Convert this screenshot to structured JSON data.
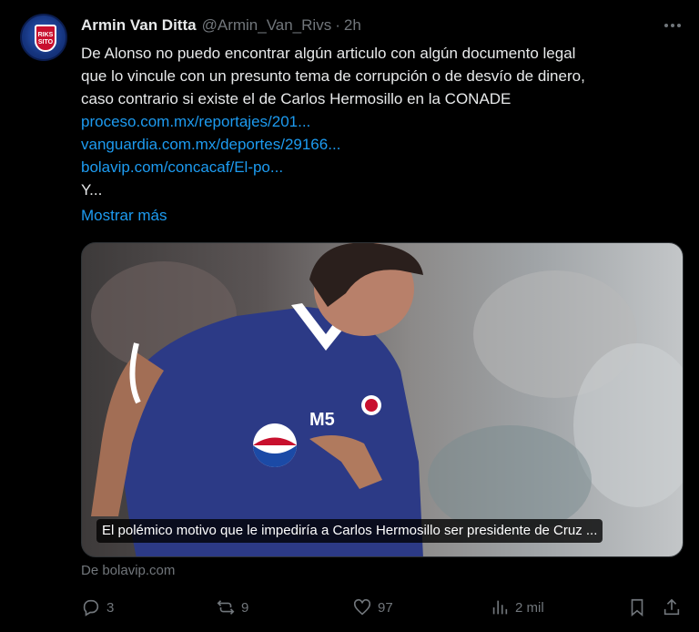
{
  "tweet": {
    "author_name": "Armin Van Ditta",
    "author_handle": "@Armin_Van_Rivs",
    "separator": "·",
    "time": "2h",
    "avatar_text": "RIKS SITO",
    "text_lines": [
      "De Alonso no puedo encontrar algún articulo con algún documento legal",
      "que lo vincule con un presunto tema de corrupción o de desvío de dinero,",
      "caso contrario si existe el de Carlos Hermosillo en la CONADE"
    ],
    "links": [
      "proceso.com.mx/reportajes/201...",
      "vanguardia.com.mx/deportes/29166...",
      "bolavip.com/concacaf/El-po..."
    ],
    "trailing_text": "Y...",
    "show_more": "Mostrar más"
  },
  "card": {
    "caption": "El polémico motivo que le impediría a Carlos Hermosillo ser presidente de Cruz ...",
    "source": "De bolavip.com",
    "image_description_icon": "soccer-player-photo",
    "jersey_text": "M5"
  },
  "actions": {
    "replies": "3",
    "reposts": "9",
    "likes": "97",
    "views": "2 mil"
  },
  "colors": {
    "background": "#000000",
    "text": "#e7e9ea",
    "muted": "#71767b",
    "link": "#1d9bf0"
  }
}
